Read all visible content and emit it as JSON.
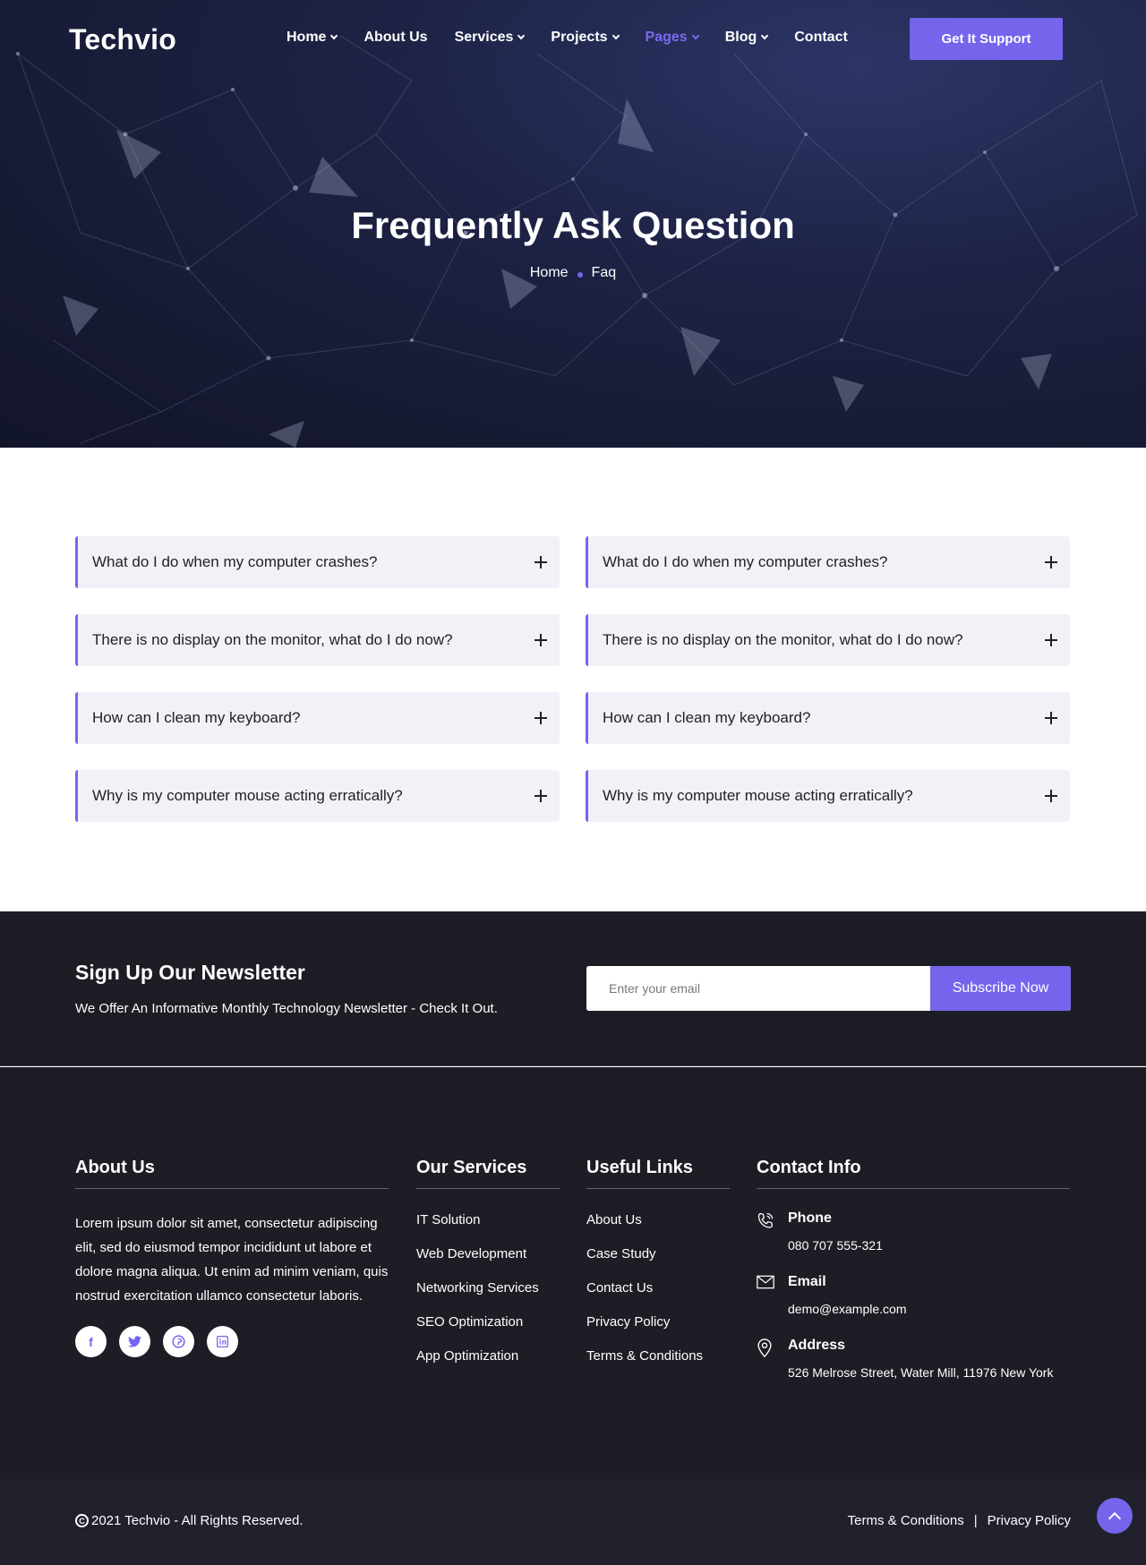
{
  "header": {
    "logo": "Techvio",
    "nav": [
      {
        "label": "Home",
        "dropdown": true,
        "active": false
      },
      {
        "label": "About Us",
        "dropdown": false,
        "active": false
      },
      {
        "label": "Services",
        "dropdown": true,
        "active": false
      },
      {
        "label": "Projects",
        "dropdown": true,
        "active": false
      },
      {
        "label": "Pages",
        "dropdown": true,
        "active": true
      },
      {
        "label": "Blog",
        "dropdown": true,
        "active": false
      },
      {
        "label": "Contact",
        "dropdown": false,
        "active": false
      }
    ],
    "cta_label": "Get It Support"
  },
  "hero": {
    "title": "Frequently Ask Question",
    "breadcrumb": [
      "Home",
      "Faq"
    ]
  },
  "faq": {
    "left": [
      "What do I do when my computer crashes?",
      "There is no display on the monitor, what do I do now?",
      "How can I clean my keyboard?",
      "Why is my computer mouse acting erratically?"
    ],
    "right": [
      "What do I do when my computer crashes?",
      "There is no display on the monitor, what do I do now?",
      "How can I clean my keyboard?",
      "Why is my computer mouse acting erratically?"
    ]
  },
  "newsletter": {
    "title": "Sign Up Our Newsletter",
    "subtitle": "We Offer An Informative Monthly Technology Newsletter - Check It Out.",
    "placeholder": "Enter your email",
    "button": "Subscribe Now"
  },
  "footer": {
    "about": {
      "title": "About Us",
      "text": "Lorem ipsum dolor sit amet, consectetur adipiscing elit, sed do eiusmod tempor incididunt ut labore et dolore magna aliqua. Ut enim ad minim veniam, quis nostrud exercitation ullamco consectetur laboris.",
      "socials": [
        "facebook-icon",
        "twitter-icon",
        "pinterest-icon",
        "linkedin-icon"
      ]
    },
    "services": {
      "title": "Our Services",
      "items": [
        "IT Solution",
        "Web Development",
        "Networking Services",
        "SEO Optimization",
        "App Optimization"
      ]
    },
    "useful": {
      "title": "Useful Links",
      "items": [
        "About Us",
        "Case Study",
        "Contact Us",
        "Privacy Policy",
        "Terms & Conditions"
      ]
    },
    "contact": {
      "title": "Contact Info",
      "items": [
        {
          "icon": "phone-icon",
          "label": "Phone",
          "value": "080 707 555-321"
        },
        {
          "icon": "email-icon",
          "label": "Email",
          "value": "demo@example.com"
        },
        {
          "icon": "location-icon",
          "label": "Address",
          "value": "526 Melrose Street, Water Mill, 11976 New York"
        }
      ]
    }
  },
  "bottom": {
    "copyright": "2021 Techvio - All Rights Reserved.",
    "links": [
      "Terms & Conditions",
      "Privacy Policy"
    ],
    "separator": "|"
  },
  "colors": {
    "accent": "#7565ec",
    "dark_bg": "#1d1e25",
    "faq_bg": "#f2f1f8"
  }
}
